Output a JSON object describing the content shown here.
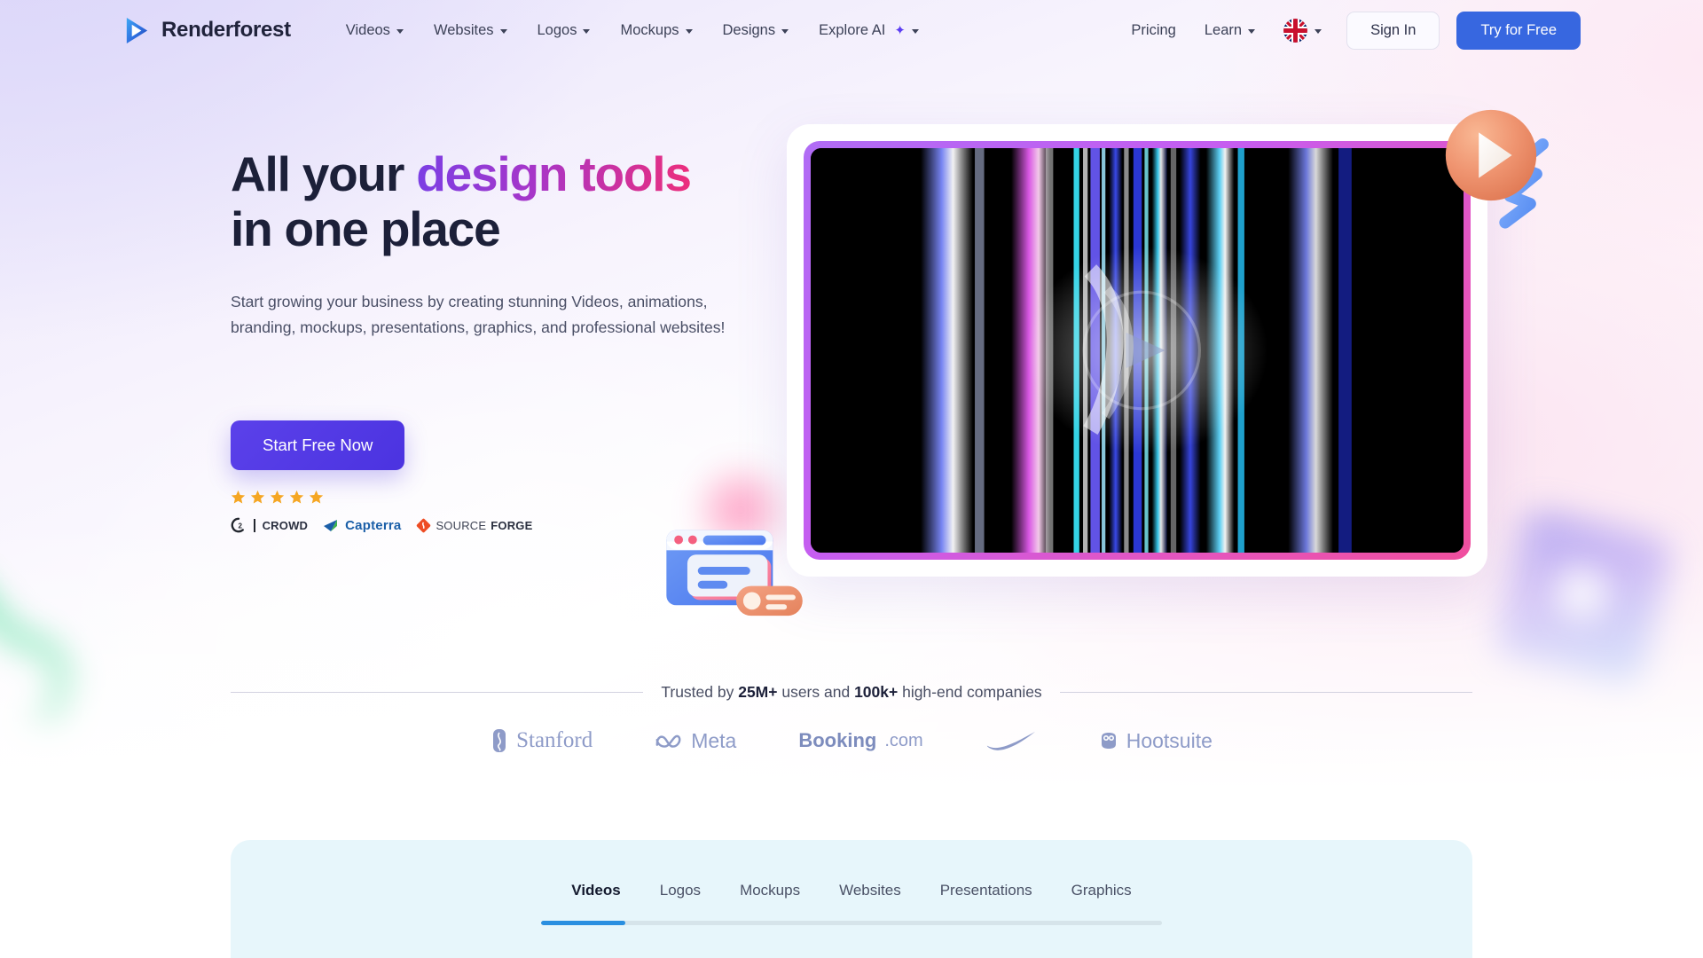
{
  "header": {
    "logo_text": "Renderforest",
    "logo_icon": "play-triangle-logo-icon",
    "nav": [
      {
        "label": "Videos",
        "icon": "chevron-down-icon"
      },
      {
        "label": "Websites",
        "icon": "chevron-down-icon"
      },
      {
        "label": "Logos",
        "icon": "chevron-down-icon"
      },
      {
        "label": "Mockups",
        "icon": "chevron-down-icon"
      },
      {
        "label": "Designs",
        "icon": "chevron-down-icon"
      },
      {
        "label": "Explore AI",
        "icon": "sparkle-icon",
        "spark": "✦"
      }
    ],
    "pricing_label": "Pricing",
    "learn_label": "Learn",
    "language_flag": "uk-flag-icon",
    "sign_in_label": "Sign In",
    "try_free_label": "Try for Free",
    "accent_blue": "#3767e0"
  },
  "hero": {
    "headline_part1": "All your ",
    "headline_gradient": "design tools",
    "headline_part2": "in one place",
    "gradient_from": "#7b3fe4",
    "gradient_to": "#ec2e7c",
    "subhead": "Start growing your business by creating stunning Videos, animations, branding, mockups, presentations, graphics, and professional websites!",
    "cta_label": "Start Free Now",
    "cta_color": "#4b33e0",
    "star_count": 5,
    "star_color": "#f5a623",
    "review_badges": [
      {
        "name": "G2 Crowd",
        "text": "CROWD",
        "mark": "G2"
      },
      {
        "name": "Capterra",
        "text": "Capterra",
        "mark": "capterra-arrow-icon"
      },
      {
        "name": "SourceForge",
        "text_light": "SOURCE",
        "text_bold": "FORGE",
        "mark": "sourceforge-diamond-icon"
      }
    ]
  },
  "video": {
    "name": "hero-video-preview",
    "border_gradient_from": "#b06cf5",
    "border_gradient_to": "#f04f9e",
    "screen_background": "#000000"
  },
  "decorations": [
    {
      "name": "play-ball-3d-decoration",
      "color": "#ef9470"
    },
    {
      "name": "blue-zigzag-decoration",
      "color": "#5e96f2"
    },
    {
      "name": "browser-card-3d-decoration",
      "color": "#5b86ef"
    },
    {
      "name": "green-squiggle-decoration",
      "color": "#6ee0ab"
    },
    {
      "name": "purple-square-decoration",
      "color": "#8f86f0"
    }
  ],
  "trusted": {
    "prefix": "Trusted by ",
    "users": "25M+",
    "middle": " users and ",
    "companies": "100k+",
    "suffix": " high-end companies",
    "brands": [
      {
        "name": "Stanford",
        "label": "Stanford",
        "icon": "stanford-seal-icon"
      },
      {
        "name": "Meta",
        "label": "Meta",
        "icon": "meta-infinity-icon"
      },
      {
        "name": "Booking.com",
        "label_bold": "Booking",
        "label_light": ".com"
      },
      {
        "name": "Nike",
        "label": "",
        "icon": "nike-swoosh-icon"
      },
      {
        "name": "Hootsuite",
        "label": "Hootsuite",
        "icon": "hootsuite-owl-icon"
      }
    ],
    "brand_color": "#8e9bc8"
  },
  "tabs_section": {
    "background": "#e7f6fb",
    "tabs": [
      {
        "label": "Videos",
        "active": true
      },
      {
        "label": "Logos",
        "active": false
      },
      {
        "label": "Mockups",
        "active": false
      },
      {
        "label": "Websites",
        "active": false
      },
      {
        "label": "Presentations",
        "active": false
      },
      {
        "label": "Graphics",
        "active": false
      }
    ],
    "progress_percent": 13.5,
    "progress_color": "#2a8fe0"
  }
}
